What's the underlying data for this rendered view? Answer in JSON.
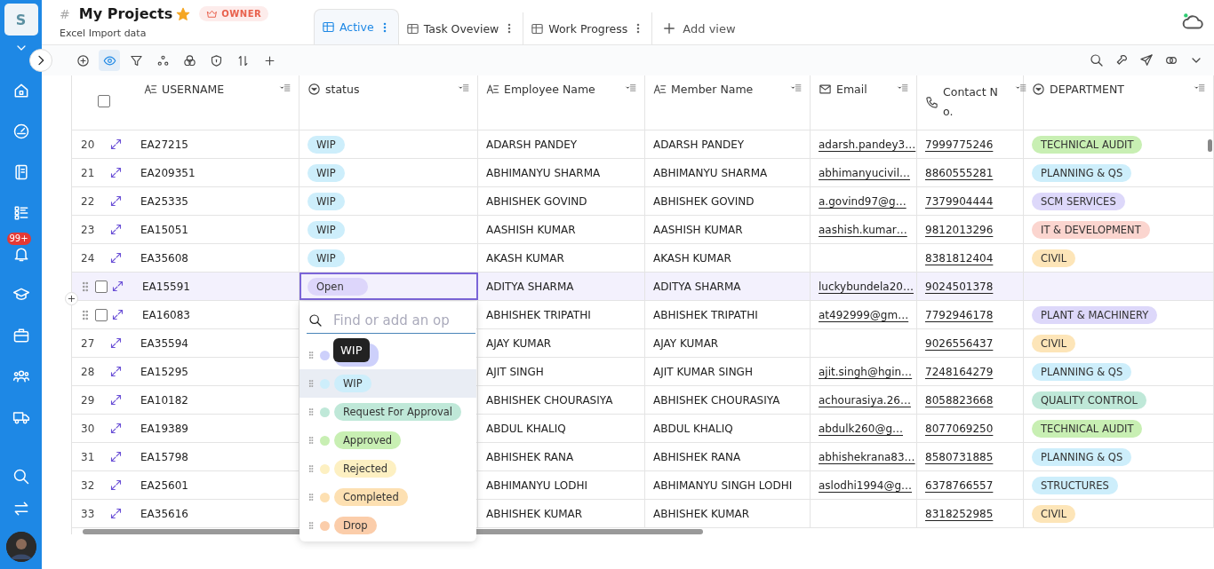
{
  "sidebar": {
    "logo": "S",
    "badge": "99+"
  },
  "header": {
    "hash": "#",
    "title": "My Projects",
    "role": "OWNER",
    "subtitle": "Excel Import data"
  },
  "tabs": [
    {
      "label": "Active",
      "selected": true
    },
    {
      "label": "Task Oveview",
      "selected": false
    },
    {
      "label": "Work Progress",
      "selected": false
    }
  ],
  "add_view": "Add view",
  "table": {
    "select_all": {
      "checked": false
    },
    "columns": [
      {
        "label": "USERNAME",
        "kind": "text"
      },
      {
        "label": "status",
        "kind": "select"
      },
      {
        "label": "Employee Name",
        "kind": "text"
      },
      {
        "label": "Member Name",
        "kind": "text"
      },
      {
        "label": "Email",
        "kind": "email"
      },
      {
        "label": "Contact N o.",
        "kind": "phone"
      },
      {
        "label": "DEPARTMENT",
        "kind": "select"
      }
    ],
    "rows": [
      {
        "number": "20",
        "username": "EA27215",
        "status": {
          "label": "WIP",
          "color": "#cdeefb"
        },
        "employee": "ADARSH PANDEY",
        "member": "ADARSH PANDEY",
        "email": "adarsh.pandey3…",
        "contact": "7999775246",
        "department": {
          "label": "TECHNICAL AUDIT",
          "color": "#c8efb3"
        },
        "selected": false
      },
      {
        "number": "21",
        "username": "EA209351",
        "status": {
          "label": "WIP",
          "color": "#cdeefb"
        },
        "employee": "ABHIMANYU SHARMA",
        "member": "ABHIMANYU SHARMA",
        "email": "abhimanyucivil…",
        "contact": "8860555281",
        "department": {
          "label": "PLANNING & QS",
          "color": "#cdeefb"
        },
        "selected": false
      },
      {
        "number": "22",
        "username": "EA25335",
        "status": {
          "label": "WIP",
          "color": "#cdeefb"
        },
        "employee": "ABHISHEK GOVIND",
        "member": "ABHISHEK GOVIND",
        "email": "a.govind97@g…",
        "contact": "7379904444",
        "department": {
          "label": "SCM SERVICES",
          "color": "#ddd8fa"
        },
        "selected": false
      },
      {
        "number": "23",
        "username": "EA15051",
        "status": {
          "label": "WIP",
          "color": "#cdeefb"
        },
        "employee": "AASHISH KUMAR",
        "member": "AASHISH KUMAR",
        "email": "aashish.kumar…",
        "contact": "9812013296",
        "department": {
          "label": "IT & DEVELOPMENT",
          "color": "#fbd5cf"
        },
        "selected": false
      },
      {
        "number": "24",
        "username": "EA35608",
        "status": {
          "label": "WIP",
          "color": "#cdeefb"
        },
        "employee": "AKASH KUMAR",
        "member": "AKASH KUMAR",
        "contact": "8381812404",
        "department": {
          "label": "CIVIL",
          "color": "#fde5b8"
        },
        "selected": false
      },
      {
        "checked": false,
        "username": "EA15591",
        "status": {
          "label": "Open",
          "color": "#ddd6fb"
        },
        "employee": "ADITYA SHARMA",
        "member": "ADITYA SHARMA",
        "email": "luckybundela20…",
        "contact": "9024501378",
        "selected": true
      },
      {
        "checked": false,
        "username": "EA16083",
        "employee": "ABHISHEK TRIPATHI",
        "member": "ABHISHEK TRIPATHI",
        "email": "at492999@gm…",
        "contact": "7792946178",
        "department": {
          "label": "PLANT & MACHINERY",
          "color": "#ddd8fa"
        },
        "selected": false
      },
      {
        "number": "27",
        "username": "EA35594",
        "employee": "AJAY KUMAR",
        "member": "AJAY KUMAR",
        "contact": "9026556437",
        "department": {
          "label": "CIVIL",
          "color": "#fde5b8"
        },
        "selected": false
      },
      {
        "number": "28",
        "username": "EA15295",
        "employee": "AJIT SINGH",
        "member": "AJIT KUMAR SINGH",
        "email": "ajit.singh@hgin…",
        "contact": "7248164279",
        "department": {
          "label": "PLANNING & QS",
          "color": "#cdeefb"
        },
        "selected": false
      },
      {
        "number": "29",
        "username": "EA10182",
        "employee": "ABHISHEK CHOURASIYA",
        "member": "ABHISHEK CHOURASIYA",
        "email": "achourasiya.26…",
        "contact": "8058823668",
        "department": {
          "label": "QUALITY CONTROL",
          "color": "#bfe8d8"
        },
        "selected": false
      },
      {
        "number": "30",
        "username": "EA19389",
        "employee": "ABDUL KHALIQ",
        "member": "ABDUL KHALIQ",
        "email": "abdulk260@g…",
        "contact": "8077069250",
        "department": {
          "label": "TECHNICAL AUDIT",
          "color": "#c8efb3"
        },
        "selected": false
      },
      {
        "number": "31",
        "username": "EA15798",
        "employee": "ABHISHEK RANA",
        "member": "ABHISHEK RANA",
        "email": "abhishekrana83…",
        "contact": "8580731885",
        "department": {
          "label": "PLANNING & QS",
          "color": "#cdeefb"
        },
        "selected": false
      },
      {
        "number": "32",
        "username": "EA25601",
        "employee": "ABHIMANYU LODHI",
        "member": "ABHIMANYU SINGH LODHI",
        "email": "aslodhi1994@g…",
        "contact": "6378766557",
        "department": {
          "label": "STRUCTURES",
          "color": "#cdeefb"
        },
        "selected": false
      },
      {
        "number": "33",
        "username": "EA35616",
        "employee": "ABHISHEK KUMAR",
        "member": "ABHISHEK KUMAR",
        "contact": "8318252985",
        "department": {
          "label": "CIVIL",
          "color": "#fde5b8"
        },
        "selected": false
      }
    ]
  },
  "dropdown": {
    "placeholder": "Find or add an op",
    "tooltip": "WIP",
    "options": [
      {
        "color": "#cdd0fb",
        "selected": false
      },
      {
        "label": "WIP",
        "color": "#cdeefb",
        "selected": true
      },
      {
        "label": "Request For Approval",
        "color": "#bfe8d8",
        "selected": false
      },
      {
        "label": "Approved",
        "color": "#c8efb3",
        "selected": false
      },
      {
        "label": "Rejected",
        "color": "#fdf0c2",
        "selected": false
      },
      {
        "label": "Completed",
        "color": "#fde0b2",
        "selected": false
      },
      {
        "label": "Drop",
        "color": "#fbcdaa",
        "selected": false
      }
    ]
  }
}
